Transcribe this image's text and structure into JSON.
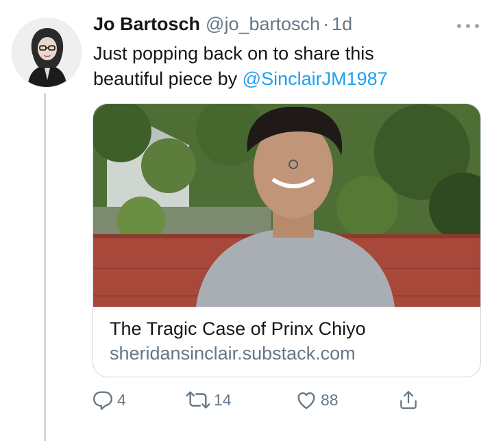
{
  "tweet": {
    "author_name": "Jo Bartosch",
    "handle": "@jo_bartosch",
    "separator": "·",
    "time": "1d",
    "text_line1": "Just popping back on to share this",
    "text_line2_prefix": "beautiful piece by ",
    "mention": "@SinclairJM1987"
  },
  "card": {
    "title": "The Tragic Case of Prinx Chiyo",
    "domain": "sheridansinclair.substack.com"
  },
  "actions": {
    "reply_count": "4",
    "retweet_count": "14",
    "like_count": "88"
  },
  "colors": {
    "link": "#1da1f2",
    "secondary_text": "#657786",
    "border": "#cfd9de"
  },
  "icons": [
    "more-icon",
    "reply-icon",
    "retweet-icon",
    "like-icon",
    "share-icon"
  ]
}
